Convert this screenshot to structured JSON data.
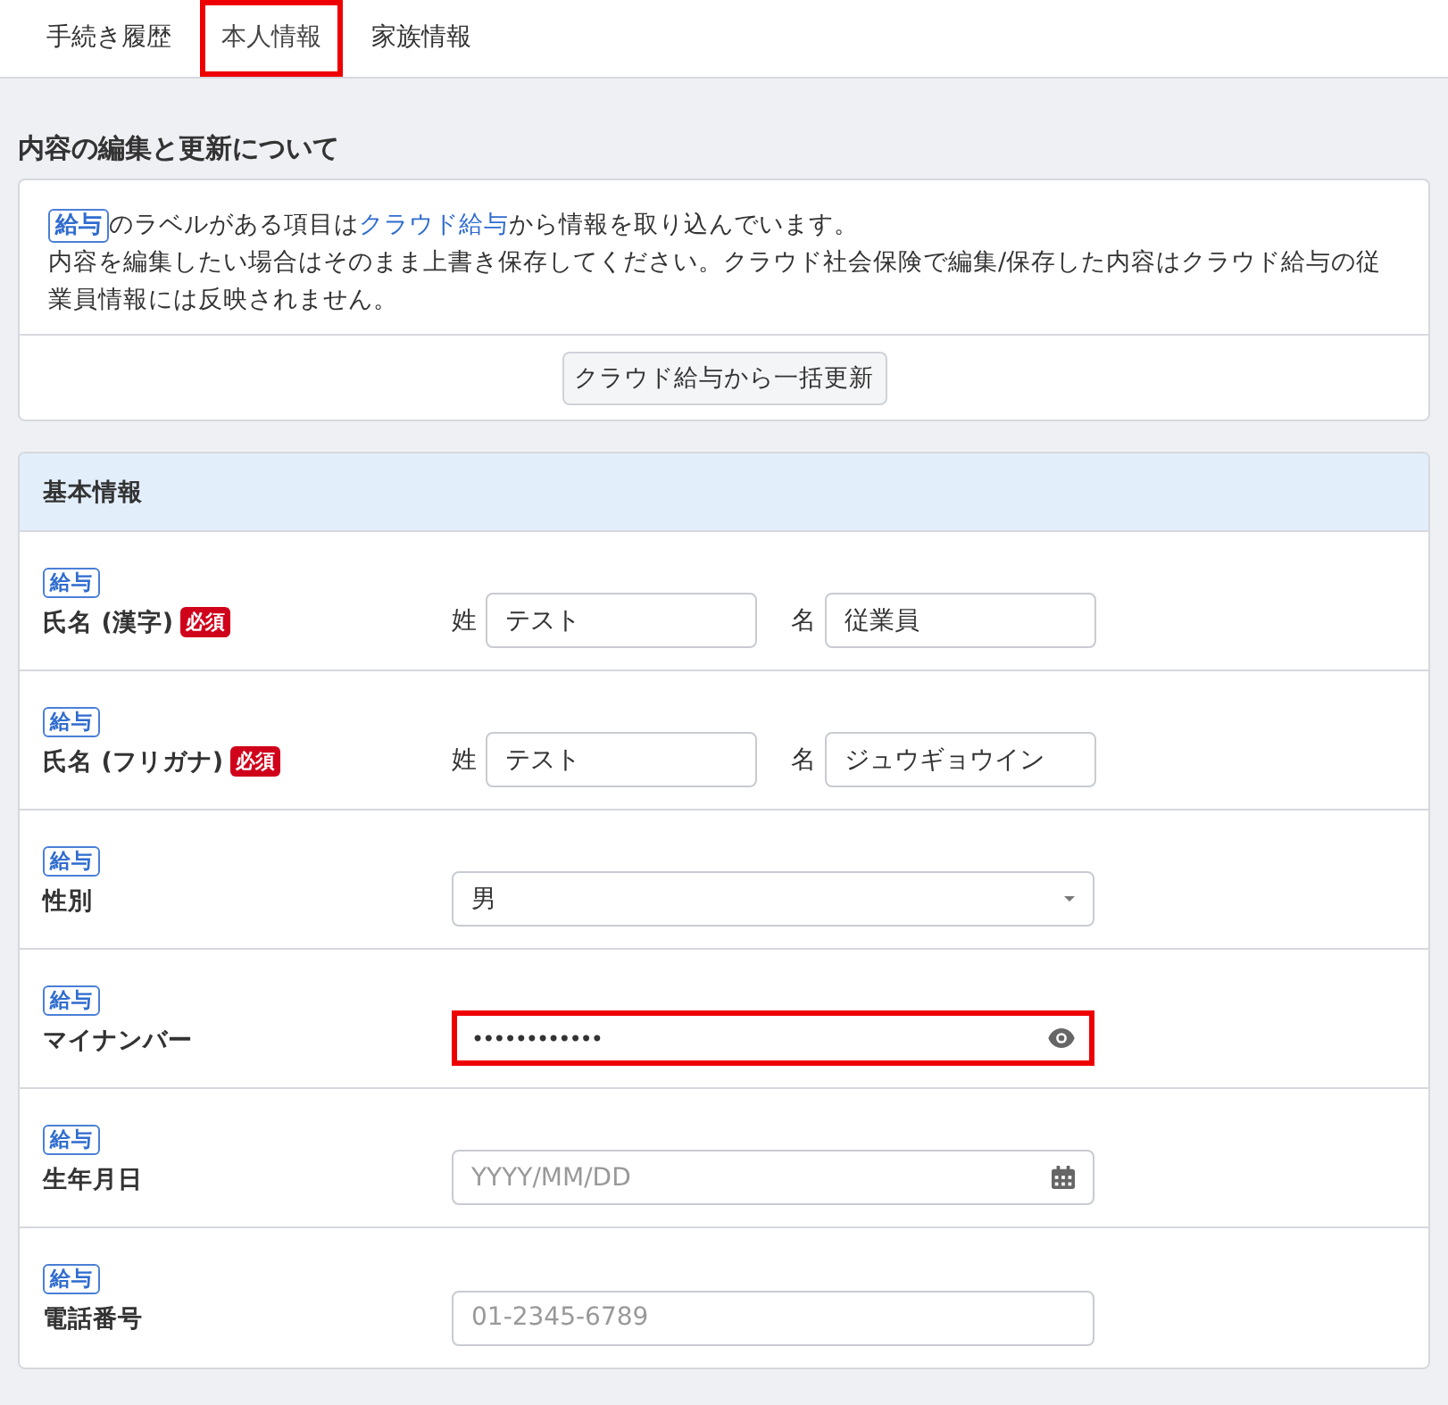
{
  "tabs": [
    {
      "label": "手続き履歴",
      "selected": false,
      "highlighted": false
    },
    {
      "label": "本人情報",
      "selected": true,
      "highlighted": true
    },
    {
      "label": "家族情報",
      "selected": false,
      "highlighted": false
    }
  ],
  "notice": {
    "title": "内容の編集と更新について",
    "badge": "給与",
    "before": "のラベルがある項目は",
    "link": "クラウド給与",
    "after": "から情報を取り込んでいます。",
    "body": "内容を編集したい場合はそのまま上書き保存してください。クラウド社会保険で編集/保存した内容はクラウド給与の従業員情報には反映されません。",
    "button": "クラウド給与から一括更新"
  },
  "form": {
    "title": "基本情報",
    "rows": [
      {
        "kind": "name_pair",
        "badge": "給与",
        "label": "氏名 (漢字)",
        "required": "必須",
        "fields": [
          {
            "prefix": "姓",
            "value": "テスト"
          },
          {
            "prefix": "名",
            "value": "従業員"
          }
        ]
      },
      {
        "kind": "name_pair",
        "badge": "給与",
        "label": "氏名 (フリガナ)",
        "required": "必須",
        "fields": [
          {
            "prefix": "姓",
            "value": "テスト"
          },
          {
            "prefix": "名",
            "value": "ジュウギョウイン"
          }
        ]
      },
      {
        "kind": "select",
        "badge": "給与",
        "label": "性別",
        "value": "男"
      },
      {
        "kind": "password",
        "badge": "給与",
        "label": "マイナンバー",
        "value": "••••••••••••",
        "highlighted": true
      },
      {
        "kind": "date",
        "badge": "給与",
        "label": "生年月日",
        "placeholder": "YYYY/MM/DD"
      },
      {
        "kind": "text",
        "badge": "給与",
        "label": "電話番号",
        "placeholder": "01-2345-6789"
      }
    ]
  }
}
